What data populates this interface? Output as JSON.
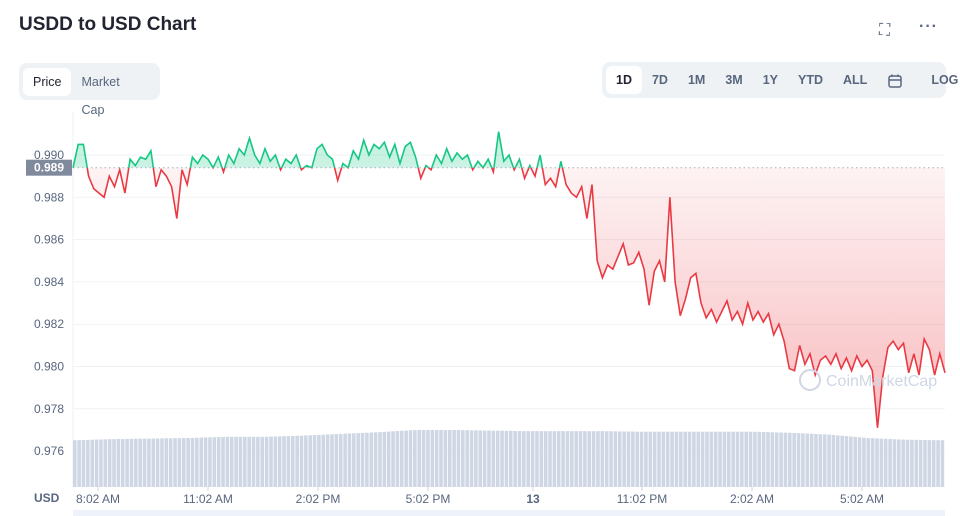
{
  "header": {
    "title": "USDD to USD Chart",
    "fullscreen_icon": "expand-icon",
    "more_icon": "more-horizontal-icon"
  },
  "view_tabs": [
    {
      "label": "Price",
      "active": true
    },
    {
      "label": "Market Cap",
      "active": false
    }
  ],
  "range_tabs": [
    {
      "label": "1D",
      "active": true
    },
    {
      "label": "7D"
    },
    {
      "label": "1M"
    },
    {
      "label": "3M"
    },
    {
      "label": "1Y"
    },
    {
      "label": "YTD"
    },
    {
      "label": "ALL"
    }
  ],
  "calendar_icon": "calendar-icon",
  "log_label": "LOG",
  "watermark": "CoinMarketCap",
  "chart_data": {
    "type": "line",
    "currency_label": "USD",
    "reference_price": 0.9894,
    "reference_label": "0.989",
    "ylim": [
      0.9745,
      0.9925
    ],
    "yticks": [
      "0.990",
      "0.988",
      "0.986",
      "0.984",
      "0.982",
      "0.980",
      "0.978",
      "0.976"
    ],
    "xticks": [
      "8:02 AM",
      "11:02 AM",
      "2:02 PM",
      "5:02 PM",
      "13",
      "11:02 PM",
      "2:02 AM",
      "5:02 AM"
    ],
    "colors": {
      "up": "#16c784",
      "down": "#ea3943",
      "volume": "#cfd6e4"
    },
    "grid": true,
    "values": [
      0.9894,
      0.9905,
      0.9905,
      0.989,
      0.9884,
      0.9882,
      0.988,
      0.989,
      0.9885,
      0.9893,
      0.9882,
      0.9898,
      0.9895,
      0.9899,
      0.9898,
      0.9902,
      0.9885,
      0.9893,
      0.989,
      0.9885,
      0.987,
      0.9893,
      0.9886,
      0.9899,
      0.9896,
      0.99,
      0.9898,
      0.9894,
      0.9899,
      0.9892,
      0.99,
      0.9896,
      0.9903,
      0.99,
      0.9908,
      0.99,
      0.9896,
      0.9903,
      0.9897,
      0.99,
      0.9893,
      0.9898,
      0.9896,
      0.99,
      0.9893,
      0.9895,
      0.9894,
      0.9903,
      0.9905,
      0.99,
      0.9898,
      0.9888,
      0.9896,
      0.9894,
      0.9902,
      0.9898,
      0.9907,
      0.99,
      0.9905,
      0.9903,
      0.9906,
      0.9899,
      0.9905,
      0.9896,
      0.9904,
      0.9906,
      0.9899,
      0.9889,
      0.9895,
      0.9893,
      0.99,
      0.9896,
      0.9903,
      0.9897,
      0.9901,
      0.9898,
      0.99,
      0.9893,
      0.9897,
      0.9894,
      0.9898,
      0.9892,
      0.9911,
      0.9897,
      0.99,
      0.9893,
      0.9898,
      0.9889,
      0.9895,
      0.989,
      0.99,
      0.9886,
      0.9889,
      0.9885,
      0.9897,
      0.9886,
      0.9882,
      0.988,
      0.9885,
      0.987,
      0.9886,
      0.985,
      0.9842,
      0.9848,
      0.9846,
      0.9852,
      0.9858,
      0.9848,
      0.9849,
      0.9854,
      0.9846,
      0.9829,
      0.9845,
      0.985,
      0.984,
      0.988,
      0.984,
      0.9824,
      0.9832,
      0.9842,
      0.9844,
      0.983,
      0.9823,
      0.9827,
      0.9821,
      0.9826,
      0.9831,
      0.9822,
      0.9826,
      0.982,
      0.983,
      0.9822,
      0.9826,
      0.9821,
      0.9825,
      0.9815,
      0.982,
      0.9812,
      0.9799,
      0.9798,
      0.981,
      0.9801,
      0.9806,
      0.9796,
      0.9803,
      0.9805,
      0.9801,
      0.9806,
      0.9799,
      0.9804,
      0.9798,
      0.9805,
      0.98,
      0.9803,
      0.9798,
      0.9771,
      0.9795,
      0.9809,
      0.9812,
      0.9808,
      0.9811,
      0.9797,
      0.9806,
      0.9796,
      0.9813,
      0.9808,
      0.9796,
      0.9806,
      0.9797
    ],
    "volume_relative": [
      0.82,
      0.84,
      0.85,
      0.86,
      0.88,
      0.88,
      0.9,
      0.93,
      0.96,
      1.0,
      1.0,
      0.99,
      0.98,
      0.98,
      0.98,
      0.97,
      0.97,
      0.97,
      0.97,
      0.95,
      0.92,
      0.86,
      0.83,
      0.82
    ]
  }
}
